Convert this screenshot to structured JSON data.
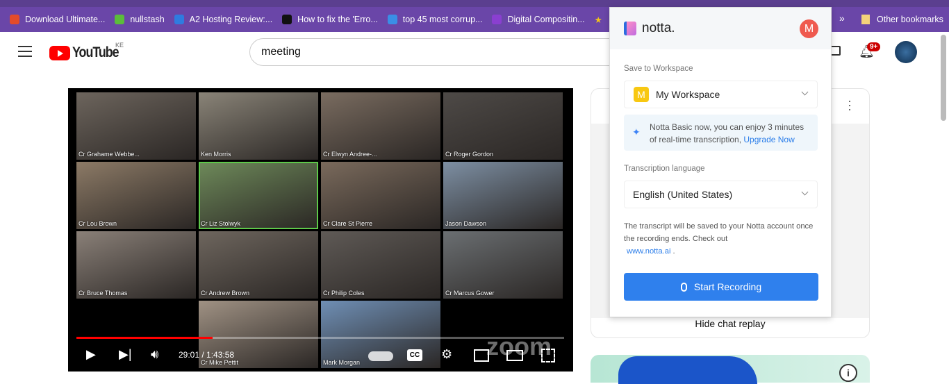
{
  "bookmarks": [
    {
      "label": "Download Ultimate...",
      "color": "#e34b2a"
    },
    {
      "label": "nullstash",
      "color": "#5bbd3b"
    },
    {
      "label": "A2 Hosting Review:...",
      "color": "#2f7be0"
    },
    {
      "label": "How to fix the 'Erro...",
      "color": "#111111"
    },
    {
      "label": "top 45 most corrup...",
      "color": "#3a8ee6"
    },
    {
      "label": "Digital Compositin...",
      "color": "#8a3fd0"
    }
  ],
  "other_bookmarks": "Other bookmarks",
  "youtube": {
    "logo": "YouTube",
    "country": "KE",
    "search_value": "meeting",
    "notification_badge": "9+"
  },
  "video": {
    "participants": [
      "Cr Grahame Webbe...",
      "Ken Morris",
      "Cr Elwyn Andree-...",
      "Cr Roger Gordon",
      "Cr Lou Brown",
      "Cr Liz Stolwyk",
      "Cr Clare St Pierre",
      "Jason Dawson",
      "Cr Bruce Thomas",
      "Cr Andrew Brown",
      "Cr Philip Coles",
      "Cr Marcus Gower",
      "Cr Mike Pettit",
      "Mark Morgan"
    ],
    "time": "29:01 / 1:43:58",
    "progress": 0.279,
    "watermark": "zoom"
  },
  "chat": {
    "hide_label": "Hide chat replay"
  },
  "notta": {
    "brand": "notta.",
    "user_initial": "M",
    "save_label": "Save to Workspace",
    "workspace_initial": "M",
    "workspace": "My Workspace",
    "promo_text": "Notta Basic now, you can enjoy 3 minutes of real-time transcription,",
    "promo_link": "Upgrade Now",
    "language_label": "Transcription language",
    "language": "English (United States)",
    "note": "The transcript will be saved to your Notta account once the recording ends. Check out",
    "note_link": "www.notta.ai",
    "note_end": ".",
    "start_button": "Start Recording"
  }
}
